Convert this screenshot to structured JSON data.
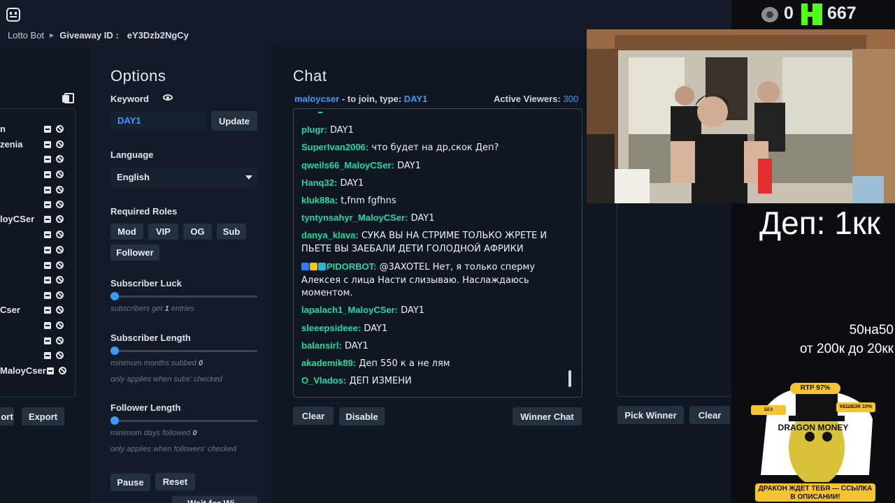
{
  "header": {
    "app_name": "Lotto Bot",
    "giveaway_label": "Giveaway ID :",
    "giveaway_id": "eY3Dzb2NgCy"
  },
  "left_list": {
    "rows": [
      {
        "name": "n"
      },
      {
        "name": "zenia"
      },
      {
        "name": ""
      },
      {
        "name": ""
      },
      {
        "name": ""
      },
      {
        "name": ""
      },
      {
        "name": "loyCSer"
      },
      {
        "name": ""
      },
      {
        "name": ""
      },
      {
        "name": ""
      },
      {
        "name": ""
      },
      {
        "name": ""
      },
      {
        "name": "Cser"
      },
      {
        "name": ""
      },
      {
        "name": ""
      },
      {
        "name": ""
      },
      {
        "name": "MaloyCser"
      }
    ],
    "import_label": "ort",
    "export_label": "Export"
  },
  "options": {
    "title": "Options",
    "keyword_label": "Keyword",
    "keyword_value": "DAY1",
    "update_label": "Update",
    "language_label": "Language",
    "language_value": "English",
    "roles_label": "Required Roles",
    "roles": [
      "Mod",
      "VIP",
      "OG",
      "Sub",
      "Follower"
    ],
    "sub_luck_label": "Subscriber Luck",
    "sub_luck_hint_pre": "subscribers get",
    "sub_luck_value": "1",
    "sub_luck_hint_post": "entries",
    "sub_length_label": "Subscriber Length",
    "sub_length_hint_pre": "minimum months subbed",
    "sub_length_value": "0",
    "sub_length_hint2": "only applies when subs' checked",
    "follower_length_label": "Follower Length",
    "follower_length_hint_pre": "minimum days followed",
    "follower_length_value": "0",
    "follower_length_hint2": "only applies when followers' checked",
    "pause_label": "Pause",
    "reset_label": "Reset",
    "wait_label": "Wait for Wi..."
  },
  "chat": {
    "title": "Chat",
    "channel": "maloycser",
    "join_text": "- to join, type:",
    "join_keyword": "DAY1",
    "viewers_label": "Active Viewers:",
    "viewers_count": "300",
    "messages": [
      {
        "user": "plugr:",
        "text": "DAY1"
      },
      {
        "user": "SuperIvan2006:",
        "text": "что будет на др,скок Деп?"
      },
      {
        "user": "qweils66_MaloyCSer:",
        "text": "DAY1"
      },
      {
        "user": "Hanq32:",
        "text": "DAY1"
      },
      {
        "user": "kluk88a:",
        "text": "t,fnm fgfhns"
      },
      {
        "user": "tyntynsahyr_MaloyCSer:",
        "text": "DAY1"
      },
      {
        "user": "danya_klava:",
        "text": "СУКА ВЫ НА СТРИМЕ ТОЛЬКО ЖРЕТЕ И ПЬЕТЕ ВЫ ЗАЕБАЛИ ДЕТИ ГОЛОДНОЙ АФРИКИ"
      },
      {
        "user": "PIDORBOT:",
        "text": "@3AXOTEL Нет, я только сперму Алексея с лица Насти слизываю. Наслаждаюсь моментом."
      },
      {
        "user": "lapalach1_MaloyCSer:",
        "text": "DAY1"
      },
      {
        "user": "sleeepsideee:",
        "text": "DAY1"
      },
      {
        "user": "balansirl:",
        "text": "DAY1"
      },
      {
        "user": "akademik89:",
        "text": "Деп 550 к а не лям"
      },
      {
        "user": "O_Vlados:",
        "text": "ДЕП ИЗМЕНИ"
      }
    ],
    "clear_label": "Clear",
    "disable_label": "Disable",
    "winner_chat_label": "Winner Chat"
  },
  "winner_panel": {
    "pick_label": "Pick Winner",
    "clear_label": "Clear"
  },
  "stream_overlay": {
    "viewers": "0",
    "kick_count": "667",
    "deposit_text": "Деп: 1кк",
    "line1": "50на50",
    "line2": "от 200к до 20кк",
    "promo_rtp": "RTP 97%",
    "promo_cashback": "КЕШБЭК 10%",
    "promo_noverify": "БЕЗ ВЕРИФИКАЦИИ",
    "promo_brand": "DRAGON MONEY",
    "promo_banner": "ДРАКОН ЖДЕТ ТЕБЯ — ССЫЛКА В ОПИСАНИИ!"
  }
}
